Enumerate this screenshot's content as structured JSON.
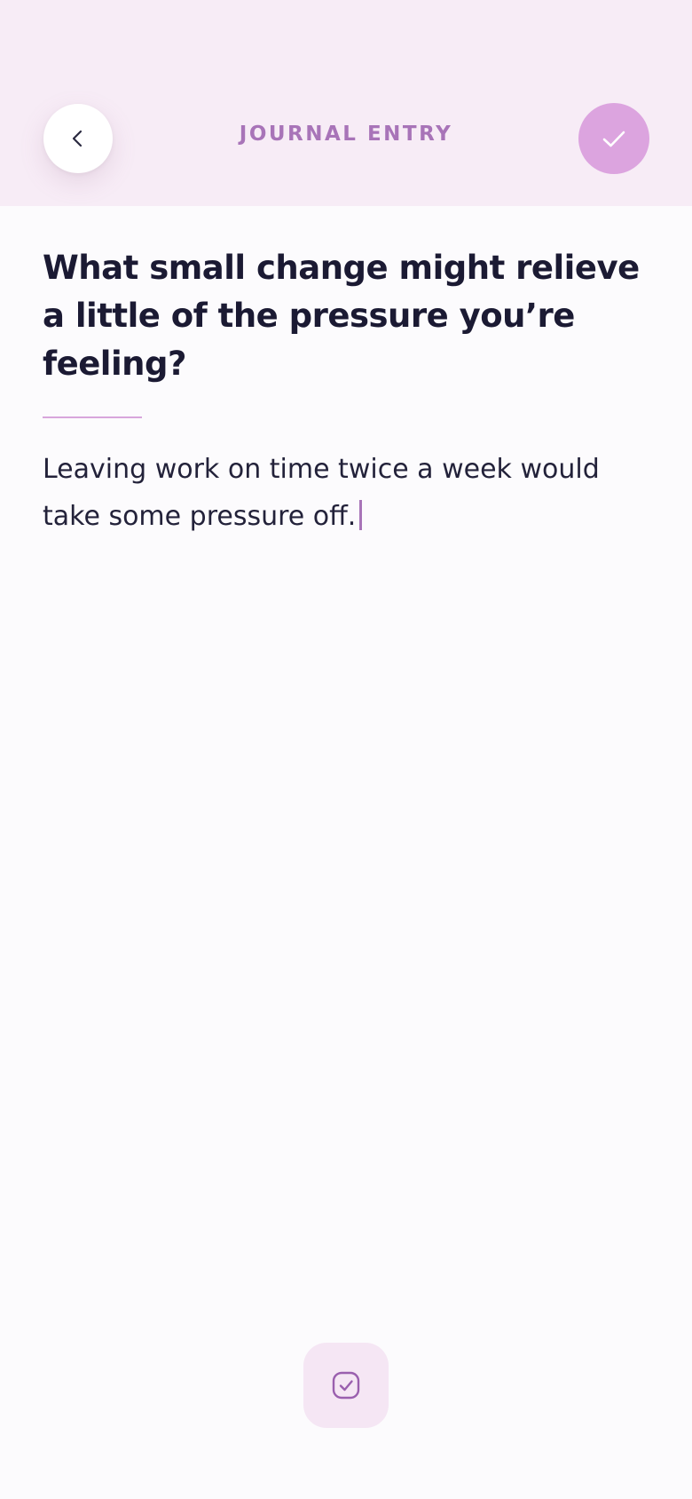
{
  "header": {
    "title": "JOURNAL ENTRY",
    "back_icon": "chevron-left-icon",
    "save_icon": "check-icon"
  },
  "entry": {
    "question": "What small change might relieve a little of the pressure you’re feeling?",
    "answer": "Leaving work on time twice a week would take some pressure off."
  },
  "footer": {
    "action_icon": "check-square-icon"
  },
  "colors": {
    "header_background": "#f7ecf6",
    "accent": "#a874b8",
    "save_button": "#dca4df",
    "text_primary": "#1b1a33"
  }
}
